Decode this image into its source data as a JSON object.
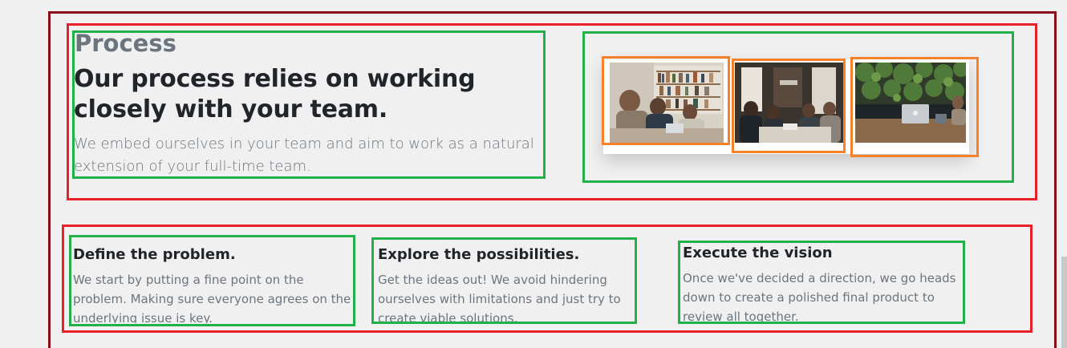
{
  "process": {
    "label": "Process",
    "heading": "Our process relies on working closely with your team.",
    "lead": "We embed ourselves in your team and aim to work as a natural extension of your full-time team."
  },
  "photos": [
    {
      "name": "team-library-photo"
    },
    {
      "name": "team-meeting-photo"
    },
    {
      "name": "workspace-laptop-photo"
    }
  ],
  "steps": [
    {
      "title": "Define the problem.",
      "text": "We start by putting a fine point on the problem. Making sure everyone agrees on the underlying issue is key."
    },
    {
      "title": "Explore the possibilities.",
      "text": "Get the ideas out! We avoid hindering ourselves with limitations and just try to create viable solutions."
    },
    {
      "title": "Execute the vision",
      "text": "Once we've decided a direction, we go heads down to create a polished final product to review all together."
    }
  ],
  "colors": {
    "outer_frame": "#8b0a1a",
    "section_frame": "#e8202a",
    "block_frame": "#22b04b",
    "image_frame": "#f5822a"
  }
}
